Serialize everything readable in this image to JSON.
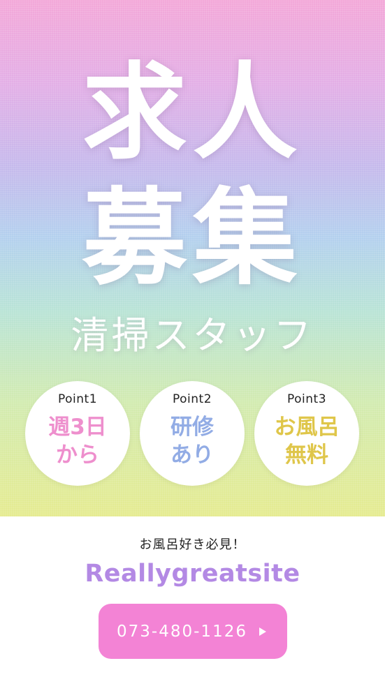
{
  "hero": {
    "title_line_1": "求人",
    "title_line_2": "募集",
    "subtitle": "清掃スタッフ"
  },
  "points": [
    {
      "label": "Point1",
      "text": "週3日\nから",
      "color": "#ee8fcd"
    },
    {
      "label": "Point2",
      "text": "研修\nあり",
      "color": "#92ace5"
    },
    {
      "label": "Point3",
      "text": "お風呂\n無料",
      "color": "#dfc64a"
    }
  ],
  "footer": {
    "tagline": "お風呂好き必見！",
    "site_name": "Reallygreatsite",
    "phone": "073-480-1126",
    "button_icon": "play-icon",
    "button_color": "#f383d5",
    "site_color": "#b389e4"
  }
}
